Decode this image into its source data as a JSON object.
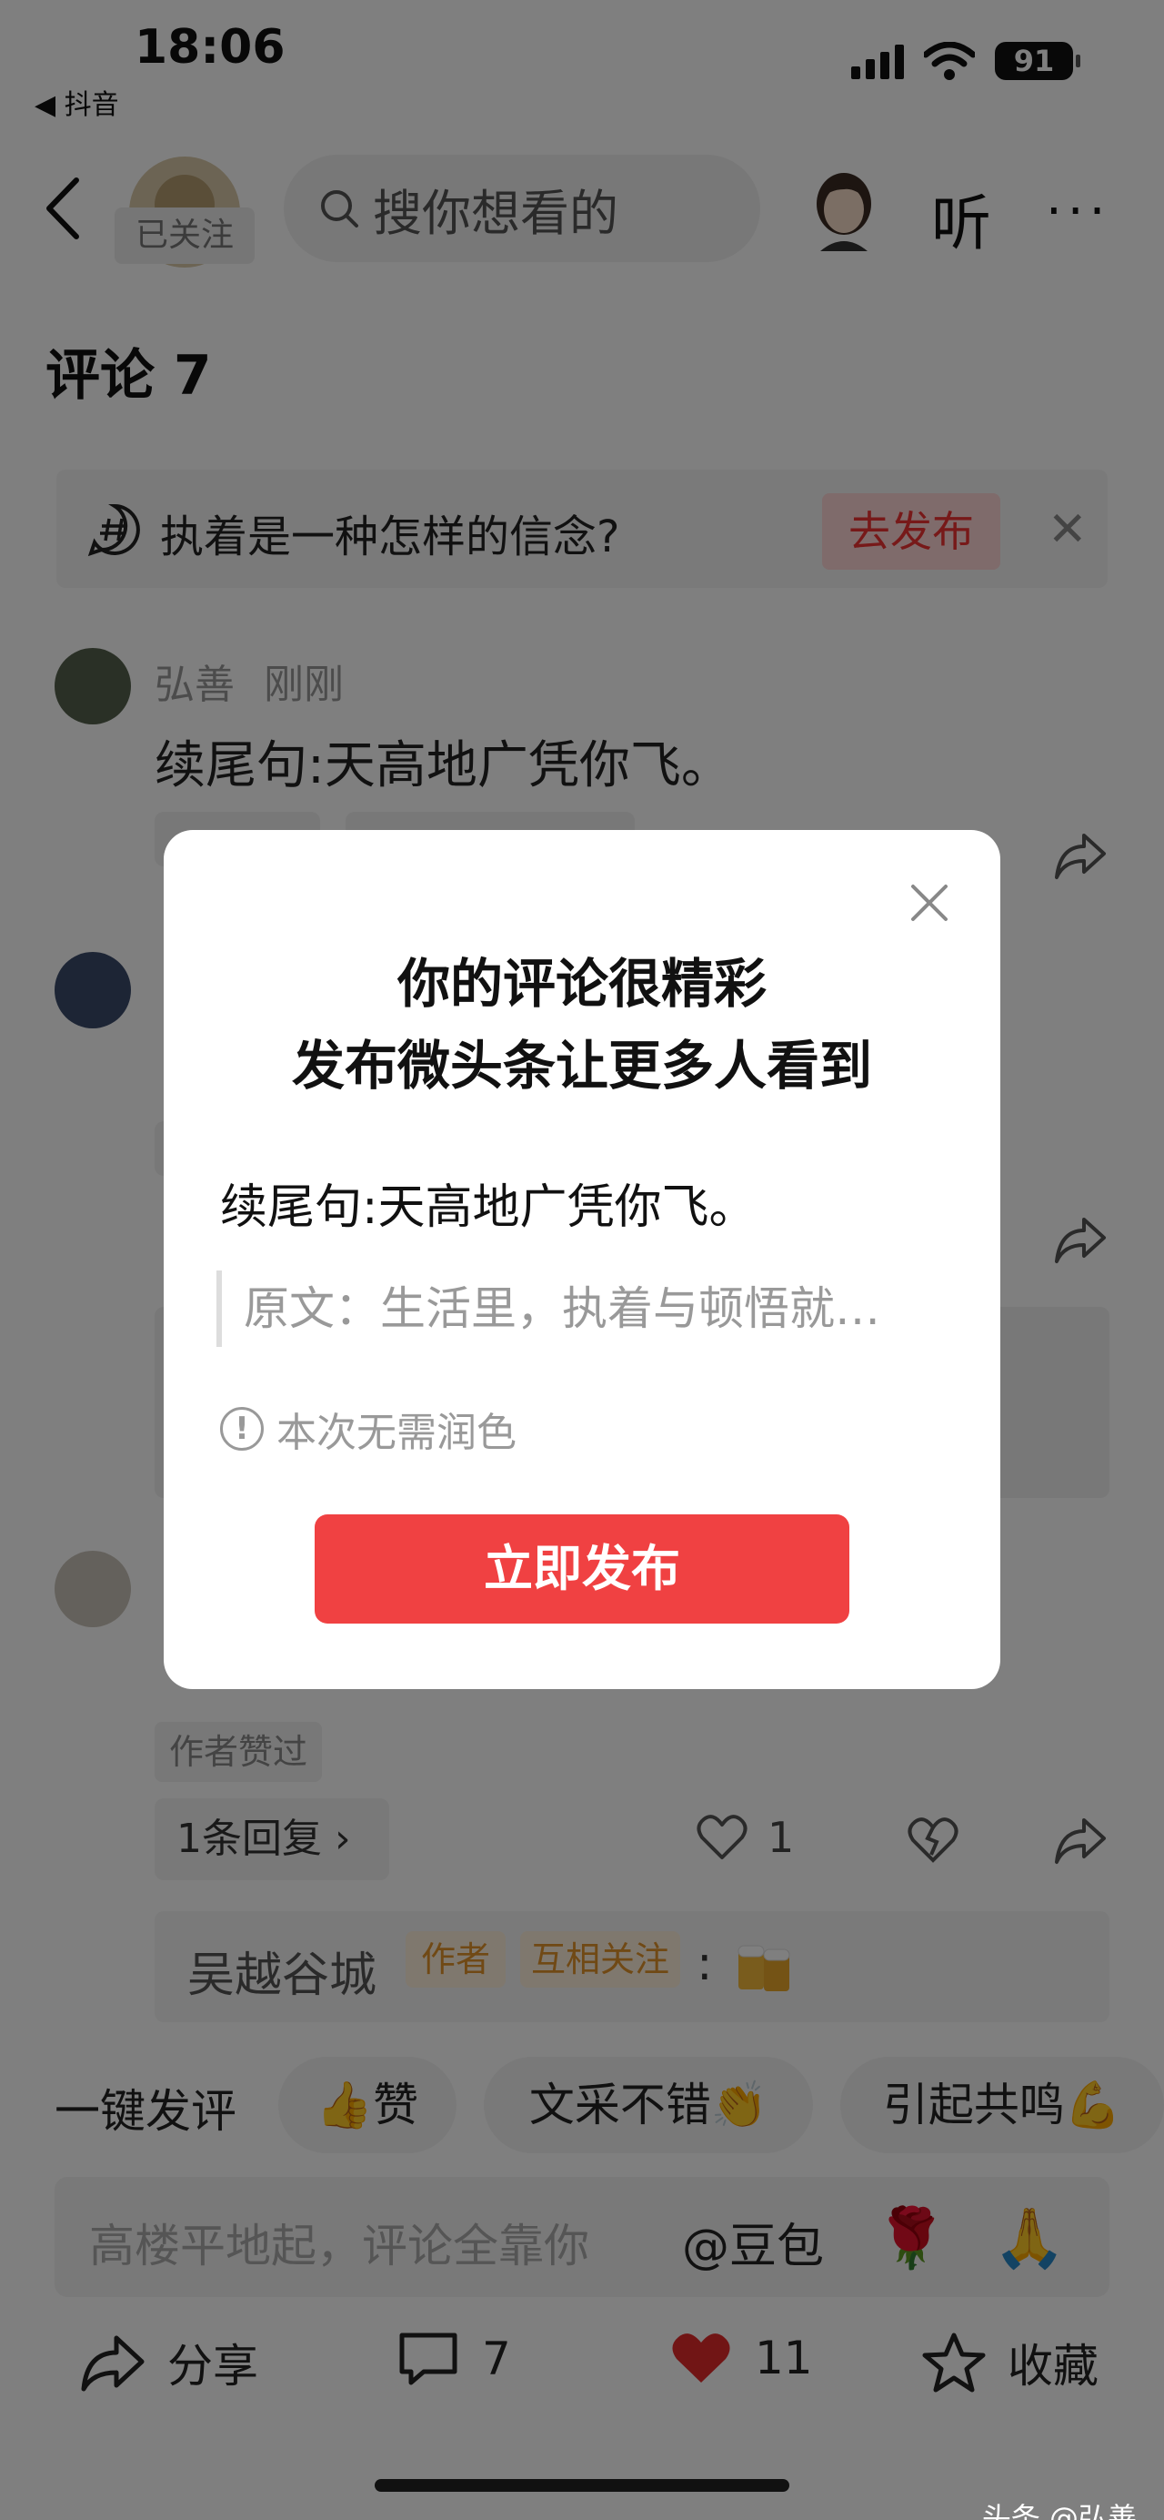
{
  "status_bar": {
    "time": "18:06",
    "back_app": "◀ 抖音",
    "battery": "91"
  },
  "nav": {
    "followed_tag": "已关注",
    "search_placeholder": "搜你想看的",
    "listen_label": "听",
    "more_label": "···"
  },
  "comments": {
    "title": "评论 7",
    "topic": {
      "text": "执着是一种怎样的信念?",
      "publish_label": "去发布"
    },
    "items": [
      {
        "name": "弘善",
        "time": "刚刚",
        "text": "续尾句:天高地广凭你飞。"
      }
    ],
    "author_liked_tag": "作者赞过",
    "reply_label": "1条回复",
    "like_count": "1",
    "reply_preview": {
      "name": "吴越谷城",
      "badge_author": "作者",
      "badge_mutual": "互相关注",
      "colon": ":"
    }
  },
  "quick_reply": {
    "label": "一键发评",
    "chips": [
      "👍赞",
      "文采不错👏",
      "引起共鸣💪"
    ]
  },
  "input_bar": {
    "placeholder": "高楼平地起，评论全靠你",
    "at_label": "@豆包",
    "emoji1": "🌹",
    "emoji2": "🙏"
  },
  "bottom_bar": {
    "share_label": "分享",
    "comment_count": "7",
    "like_count": "11",
    "collect_label": "收藏"
  },
  "watermark": "头条 @弘善",
  "modal": {
    "title_line1": "你的评论很精彩",
    "title_line2": "发布微头条让更多人看到",
    "comment_text": "续尾句:天高地广凭你飞。",
    "quote_text": "原文：生活里，执着与顿悟就…",
    "note": "本次无需润色",
    "publish_label": "立即发布"
  },
  "colors": {
    "accent_red": "#f04142",
    "overlay": "rgba(0,0,0,0.5)"
  }
}
